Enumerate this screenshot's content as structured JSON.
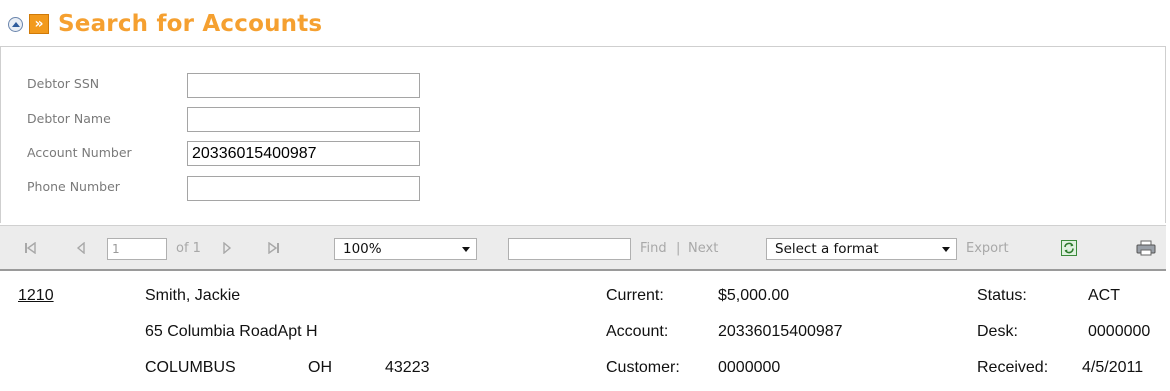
{
  "header": {
    "title": "Search for Accounts"
  },
  "search": {
    "fields": [
      {
        "label": "Debtor SSN",
        "value": ""
      },
      {
        "label": "Debtor Name",
        "value": ""
      },
      {
        "label": "Account Number",
        "value": "20336015400987"
      },
      {
        "label": "Phone Number",
        "value": ""
      }
    ]
  },
  "toolbar": {
    "page_value": "1",
    "page_of": "of 1",
    "zoom": "100%",
    "find_label": "Find",
    "separator": "|",
    "next_label": "Next",
    "format_placeholder": "Select a format",
    "export_label": "Export",
    "icons": [
      "first-page-icon",
      "prev-page-icon",
      "next-page-icon",
      "last-page-icon",
      "refresh-icon",
      "print-icon"
    ]
  },
  "result": {
    "id": "1210",
    "name": "Smith, Jackie",
    "address1": "65 Columbia RoadApt H",
    "city": "COLUMBUS",
    "state": "OH",
    "zip": "43223",
    "current_label": "Current:",
    "current_value": "$5,000.00",
    "account_label": "Account:",
    "account_value": "20336015400987",
    "customer_label": "Customer:",
    "customer_value": "0000000",
    "status_label": "Status:",
    "status_value": "ACT",
    "desk_label": "Desk:",
    "desk_value": "0000000",
    "received_label": "Received:",
    "received_value": "4/5/2011"
  },
  "colors": {
    "title": "#f5a030",
    "accent": "#f29a1d",
    "label": "#7a7a7a",
    "toolbar_bg": "#ececec"
  }
}
